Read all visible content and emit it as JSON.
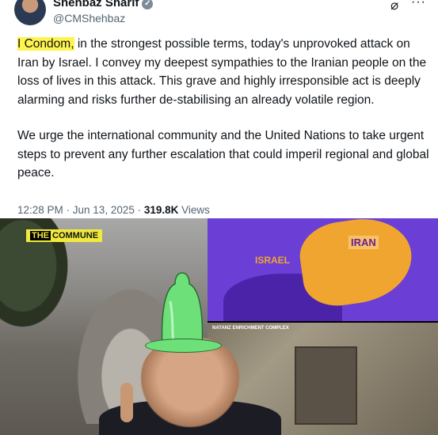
{
  "tweet": {
    "author_name": "Shehbaz Sharif",
    "author_handle": "@CMShehbaz",
    "highlighted_text": "I Condom,",
    "paragraph1_rest": " in the strongest possible terms, today's unprovoked attack on Iran by Israel. I convey my deepest sympathies to the Iranian people on the loss of lives in this attack. This grave and highly irresponsible act is deeply alarming and risks further de-stabilising an already volatile region.",
    "paragraph2": "We urge the international community and the United Nations to take urgent steps to prevent any further escalation that could imperil regional and global peace.",
    "timestamp": "12:28 PM · Jun 13, 2025 · ",
    "views_count": "319.8K",
    "views_label": " Views",
    "highlight_color": "#fff34d"
  },
  "meme": {
    "brand_the": "THE",
    "brand_commune": "COMMUNE",
    "map_label_israel": "ISRAEL",
    "map_label_iran": "IRAN",
    "sat_caption": "NATANZ ENRICHMENT COMPLEX"
  }
}
